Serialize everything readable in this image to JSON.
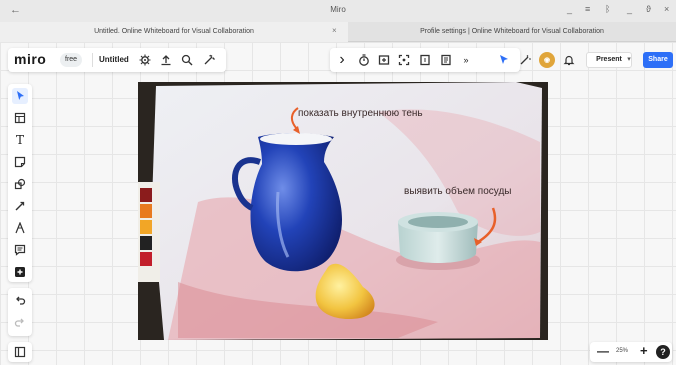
{
  "window": {
    "back_glyph": "←",
    "title": "Miro",
    "minimize": "_",
    "menu": "≡",
    "maximize": "ϑ",
    "close": "×"
  },
  "tabs": [
    {
      "label": "Untitled. Online Whiteboard for Visual Collaboration",
      "active": true
    },
    {
      "label": "Profile settings | Online Whiteboard for Visual Collaboration",
      "active": false
    }
  ],
  "tab_close": "×",
  "board": {
    "logo": "miro",
    "plan_badge": "free",
    "name": "Untitled"
  },
  "toolbar": {
    "present_label": "Present",
    "present_dropdown": "▾",
    "share_label": "Share",
    "collapse": "›",
    "more": "»"
  },
  "zoom": {
    "minus": "—",
    "value": "25%",
    "plus": "+",
    "help": "?"
  },
  "canvas_image": {
    "annotation_1": "показать внутреннюю тень",
    "annotation_2": "выявить объем посуды"
  },
  "colors": {
    "accent": "#2d6ff7",
    "jug": "#1f3fa8",
    "drape": "#e7a0a8",
    "pointer_arrow": "#e8602a"
  }
}
